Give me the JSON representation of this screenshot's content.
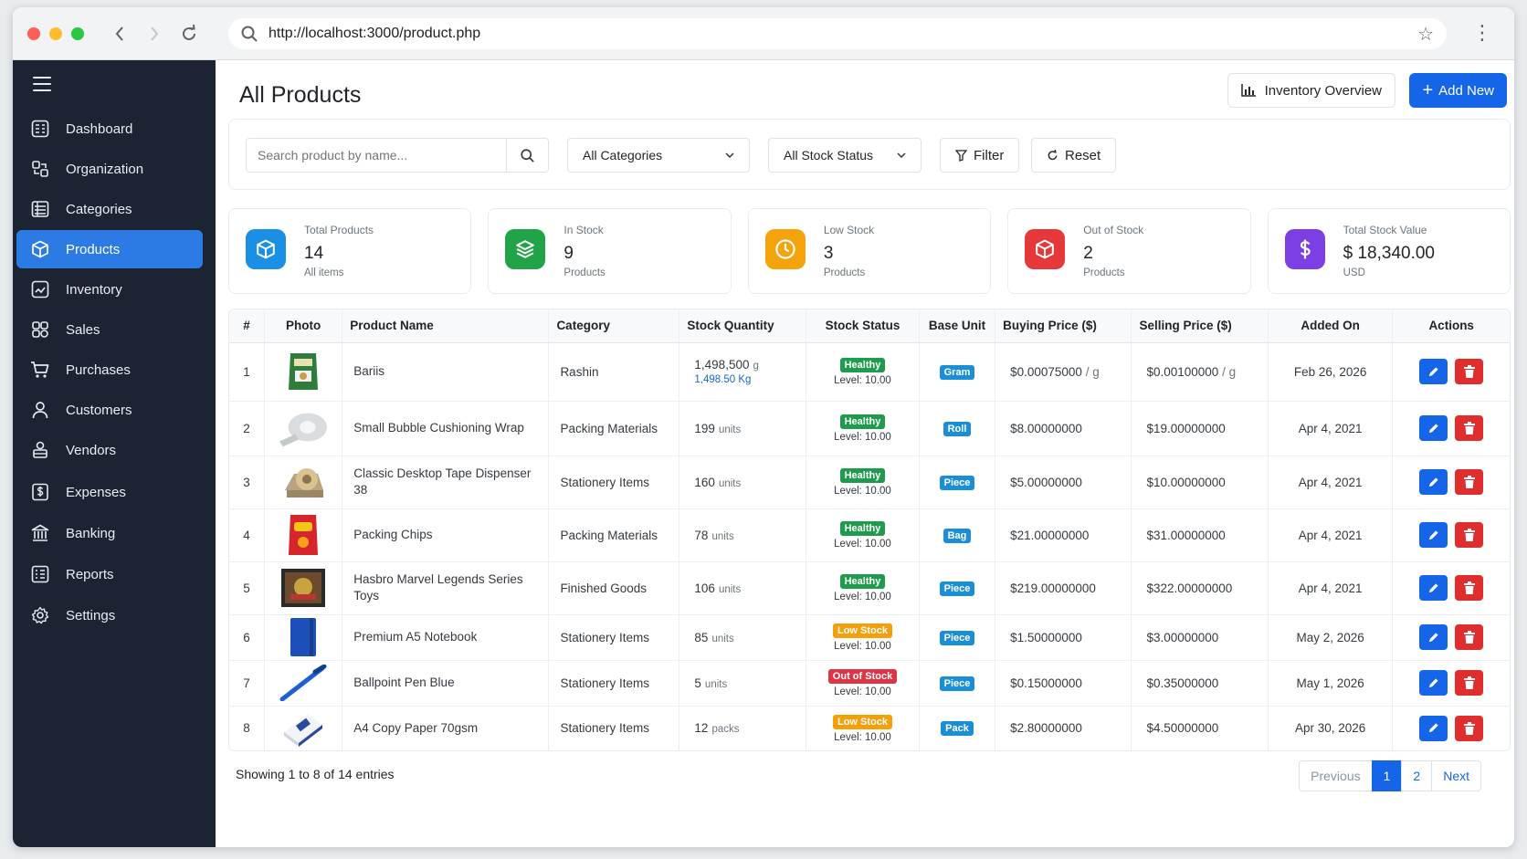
{
  "browser": {
    "url": "http://localhost:3000/product.php"
  },
  "sidebar": {
    "items": [
      {
        "label": "Dashboard",
        "icon": "dashboard-icon"
      },
      {
        "label": "Organization",
        "icon": "organization-icon"
      },
      {
        "label": "Categories",
        "icon": "categories-icon"
      },
      {
        "label": "Products",
        "icon": "box-icon"
      },
      {
        "label": "Inventory",
        "icon": "inventory-icon"
      },
      {
        "label": "Sales",
        "icon": "sales-icon"
      },
      {
        "label": "Purchases",
        "icon": "cart-icon"
      },
      {
        "label": "Customers",
        "icon": "user-icon"
      },
      {
        "label": "Vendors",
        "icon": "vendor-icon"
      },
      {
        "label": "Expenses",
        "icon": "expenses-icon"
      },
      {
        "label": "Banking",
        "icon": "bank-icon"
      },
      {
        "label": "Reports",
        "icon": "reports-icon"
      },
      {
        "label": "Settings",
        "icon": "gear-icon"
      }
    ],
    "active": "Products"
  },
  "header": {
    "title": "All Products",
    "overview_label": "Inventory Overview",
    "add_label": "Add New"
  },
  "filters": {
    "search_placeholder": "Search product by name...",
    "category": "All Categories",
    "stock_status": "All Stock Status",
    "filter_label": "Filter",
    "reset_label": "Reset"
  },
  "stats": [
    {
      "label": "Total Products",
      "value": "14",
      "sub": "All items",
      "color": "#1a8fe3"
    },
    {
      "label": "In Stock",
      "value": "9",
      "sub": "Products",
      "color": "#21a447"
    },
    {
      "label": "Low Stock",
      "value": "3",
      "sub": "Products",
      "color": "#f5a30a"
    },
    {
      "label": "Out of Stock",
      "value": "2",
      "sub": "Products",
      "color": "#e5383b"
    },
    {
      "label": "Total Stock Value",
      "value": "$ 18,340.00",
      "sub": "USD",
      "color": "#7b3fe4"
    }
  ],
  "table": {
    "columns": [
      "#",
      "Photo",
      "Product Name",
      "Category",
      "Stock Quantity",
      "Stock Status",
      "Base Unit",
      "Buying Price ($)",
      "Selling Price ($)",
      "Added On",
      "Actions"
    ],
    "rows": [
      {
        "num": "1",
        "name": "Bariis",
        "category": "Rashin",
        "qty": "1,498,500",
        "qty_unit": "g",
        "qty_sub": "1,498.50 Kg",
        "status": "Healthy",
        "level": "Level: 10.00",
        "unit": "Gram",
        "buy": "$0.00075000",
        "buy_per": " / g",
        "sell": "$0.00100000",
        "sell_per": " / g",
        "added": "Feb 26, 2026"
      },
      {
        "num": "2",
        "name": "Small Bubble Cushioning Wrap",
        "category": "Packing Materials",
        "qty": "199",
        "qty_unit": "units",
        "qty_sub": "",
        "status": "Healthy",
        "level": "Level: 10.00",
        "unit": "Roll",
        "buy": "$8.00000000",
        "buy_per": "",
        "sell": "$19.00000000",
        "sell_per": "",
        "added": "Apr 4, 2021"
      },
      {
        "num": "3",
        "name": "Classic Desktop Tape Dispenser 38",
        "category": "Stationery Items",
        "qty": "160",
        "qty_unit": "units",
        "qty_sub": "",
        "status": "Healthy",
        "level": "Level: 10.00",
        "unit": "Piece",
        "buy": "$5.00000000",
        "buy_per": "",
        "sell": "$10.00000000",
        "sell_per": "",
        "added": "Apr 4, 2021"
      },
      {
        "num": "4",
        "name": "Packing Chips",
        "category": "Packing Materials",
        "qty": "78",
        "qty_unit": "units",
        "qty_sub": "",
        "status": "Healthy",
        "level": "Level: 10.00",
        "unit": "Bag",
        "buy": "$21.00000000",
        "buy_per": "",
        "sell": "$31.00000000",
        "sell_per": "",
        "added": "Apr 4, 2021"
      },
      {
        "num": "5",
        "name": "Hasbro Marvel Legends Series Toys",
        "category": "Finished Goods",
        "qty": "106",
        "qty_unit": "units",
        "qty_sub": "",
        "status": "Healthy",
        "level": "Level: 10.00",
        "unit": "Piece",
        "buy": "$219.00000000",
        "buy_per": "",
        "sell": "$322.00000000",
        "sell_per": "",
        "added": "Apr 4, 2021"
      },
      {
        "num": "6",
        "name": "Premium A5 Notebook",
        "category": "Stationery Items",
        "qty": "85",
        "qty_unit": "units",
        "qty_sub": "",
        "status": "Low Stock",
        "level": "Level: 10.00",
        "unit": "Piece",
        "buy": "$1.50000000",
        "buy_per": "",
        "sell": "$3.00000000",
        "sell_per": "",
        "added": "May 2, 2026"
      },
      {
        "num": "7",
        "name": "Ballpoint Pen Blue",
        "category": "Stationery Items",
        "qty": "5",
        "qty_unit": "units",
        "qty_sub": "",
        "status": "Out of Stock",
        "level": "Level: 10.00",
        "unit": "Piece",
        "buy": "$0.15000000",
        "buy_per": "",
        "sell": "$0.35000000",
        "sell_per": "",
        "added": "May 1, 2026"
      },
      {
        "num": "8",
        "name": "A4 Copy Paper 70gsm",
        "category": "Stationery Items",
        "qty": "12",
        "qty_unit": "packs",
        "qty_sub": "",
        "status": "Low Stock",
        "level": "Level: 10.00",
        "unit": "Pack",
        "buy": "$2.80000000",
        "buy_per": "",
        "sell": "$4.50000000",
        "sell_per": "",
        "added": "Apr 30, 2026"
      }
    ]
  },
  "footer": {
    "showing": "Showing 1 to 8 of 14 entries",
    "previous": "Previous",
    "pages": [
      "1",
      "2"
    ],
    "next": "Next"
  }
}
